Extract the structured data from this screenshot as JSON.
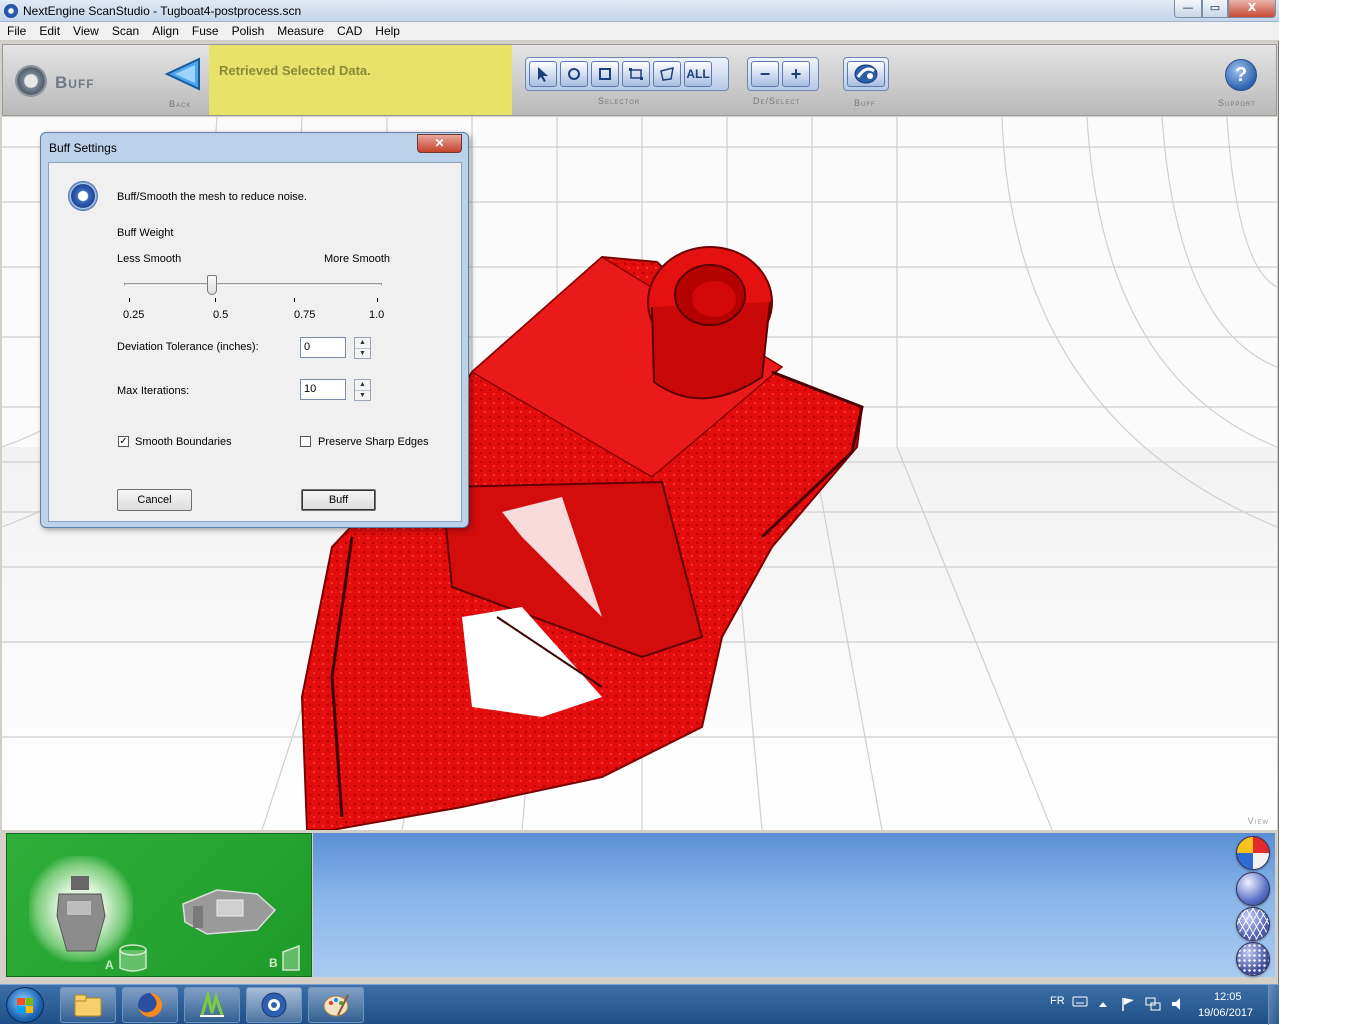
{
  "window": {
    "title": "NextEngine ScanStudio - Tugboat4-postprocess.scn",
    "controls": {
      "minimize": "—",
      "maximize": "▭",
      "close": "X"
    }
  },
  "menu": [
    "File",
    "Edit",
    "View",
    "Scan",
    "Align",
    "Fuse",
    "Polish",
    "Measure",
    "CAD",
    "Help"
  ],
  "toolbar": {
    "mode_label": "Buff",
    "back_caption": "Back",
    "status_message": "Retrieved Selected Data.",
    "selector_caption": "Selector",
    "selector_tools": [
      "arrow",
      "circle",
      "square",
      "rect",
      "poly",
      "ALL"
    ],
    "deselect_caption": "De/Select",
    "deselect_tools": [
      "−",
      "+"
    ],
    "buff_caption": "Buff",
    "support_caption": "Support",
    "help_glyph": "?"
  },
  "viewport": {
    "label": "View",
    "mesh_color": "#e30d0d"
  },
  "dialog": {
    "title": "Buff Settings",
    "description": "Buff/Smooth the mesh to reduce noise.",
    "weight_label": "Buff Weight",
    "less_label": "Less Smooth",
    "more_label": "More Smooth",
    "slider": {
      "min": 0.25,
      "max": 1.0,
      "value": 0.5,
      "ticks": [
        "0.25",
        "0.5",
        "0.75",
        "1.0"
      ]
    },
    "deviation_label": "Deviation Tolerance (inches):",
    "deviation_value": "0",
    "iterations_label": "Max Iterations:",
    "iterations_value": "10",
    "smooth_boundaries_label": "Smooth Boundaries",
    "smooth_boundaries_checked": true,
    "preserve_edges_label": "Preserve Sharp Edges",
    "preserve_edges_checked": false,
    "cancel_label": "Cancel",
    "buff_label": "Buff"
  },
  "thumbnails": {
    "a_label": "A",
    "b_label": "B"
  },
  "taskbar": {
    "apps": [
      "file-explorer",
      "firefox",
      "sketchup",
      "scanstudio",
      "paint"
    ],
    "lang": "FR",
    "time": "12:05",
    "date": "19/06/2017"
  }
}
